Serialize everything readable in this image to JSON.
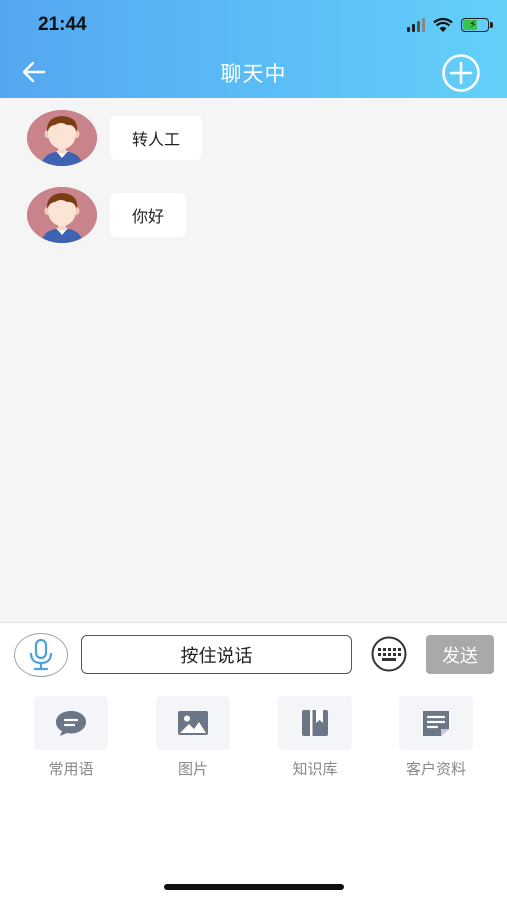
{
  "status_bar": {
    "time": "21:44"
  },
  "header": {
    "title": "聊天中"
  },
  "messages": [
    {
      "text": "转人工"
    },
    {
      "text": "你好"
    }
  ],
  "input_bar": {
    "talk_label": "按住说话",
    "send_label": "发送"
  },
  "tools": [
    {
      "label": "常用语",
      "icon": "chat-bubble-icon"
    },
    {
      "label": "图片",
      "icon": "image-icon"
    },
    {
      "label": "知识库",
      "icon": "book-icon"
    },
    {
      "label": "客户资料",
      "icon": "document-icon"
    }
  ],
  "colors": {
    "header_start": "#55a6f0",
    "header_end": "#64d0f9",
    "send_bg": "#a9a9a9",
    "tool_icon": "#6b7686"
  }
}
